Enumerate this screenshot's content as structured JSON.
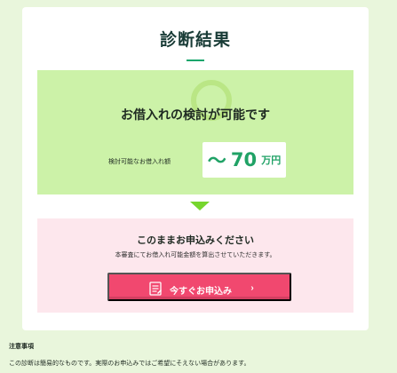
{
  "page": {
    "title": "診断結果"
  },
  "result": {
    "heading": "お借入れの検討が可能です",
    "amount_label": "検討可能なお借入れ額",
    "amount_prefix": "～",
    "amount_value": "70",
    "amount_unit": "万円"
  },
  "apply": {
    "heading": "このままお申込みください",
    "description": "本審査にてお借入れ可能金額を算出させていただきます。",
    "button_label": "今すぐお申込み",
    "button_icon": "document-icon",
    "chevron_icon": "chevron-right-icon",
    "chevron_glyph": "›"
  },
  "notes": {
    "heading": "注意事項",
    "text": "この診断は簡易的なものです。実際のお申込みではご希望にそえない場合があります。"
  },
  "colors": {
    "page_bg": "#e9f6dc",
    "title_color": "#183b36",
    "accent_green": "#20a266",
    "result_bg": "#ccf2a8",
    "apply_bg": "#fde7ed",
    "button_bg": "#f1486f"
  }
}
